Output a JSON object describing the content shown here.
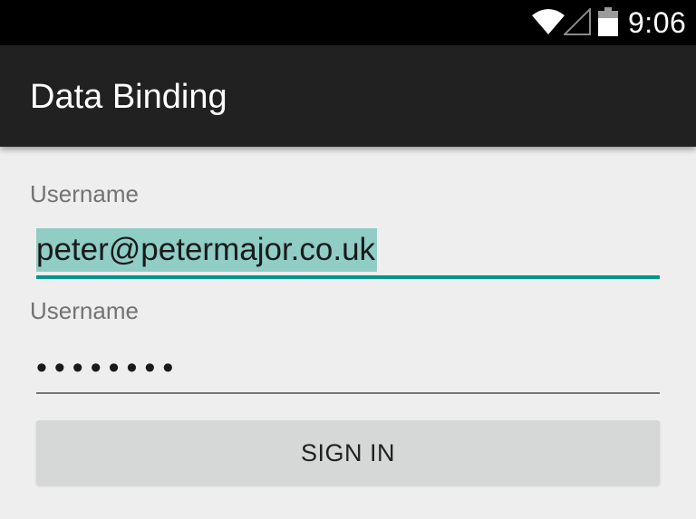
{
  "status_bar": {
    "time": "9:06",
    "icons": [
      "wifi-icon",
      "cell-signal-icon",
      "battery-icon"
    ],
    "background": "#000000"
  },
  "app_bar": {
    "title": "Data Binding",
    "background": "#212121"
  },
  "form": {
    "username_field": {
      "label": "Username",
      "value": "peter@petermajor.co.uk",
      "focused": true,
      "selected": true
    },
    "password_field": {
      "label": "Username",
      "value": "••••••••"
    },
    "submit_label": "SIGN IN"
  },
  "colors": {
    "accent": "#009688",
    "selection": "#8fcdc5",
    "background": "#eeeeee",
    "button": "#d6d7d7"
  }
}
